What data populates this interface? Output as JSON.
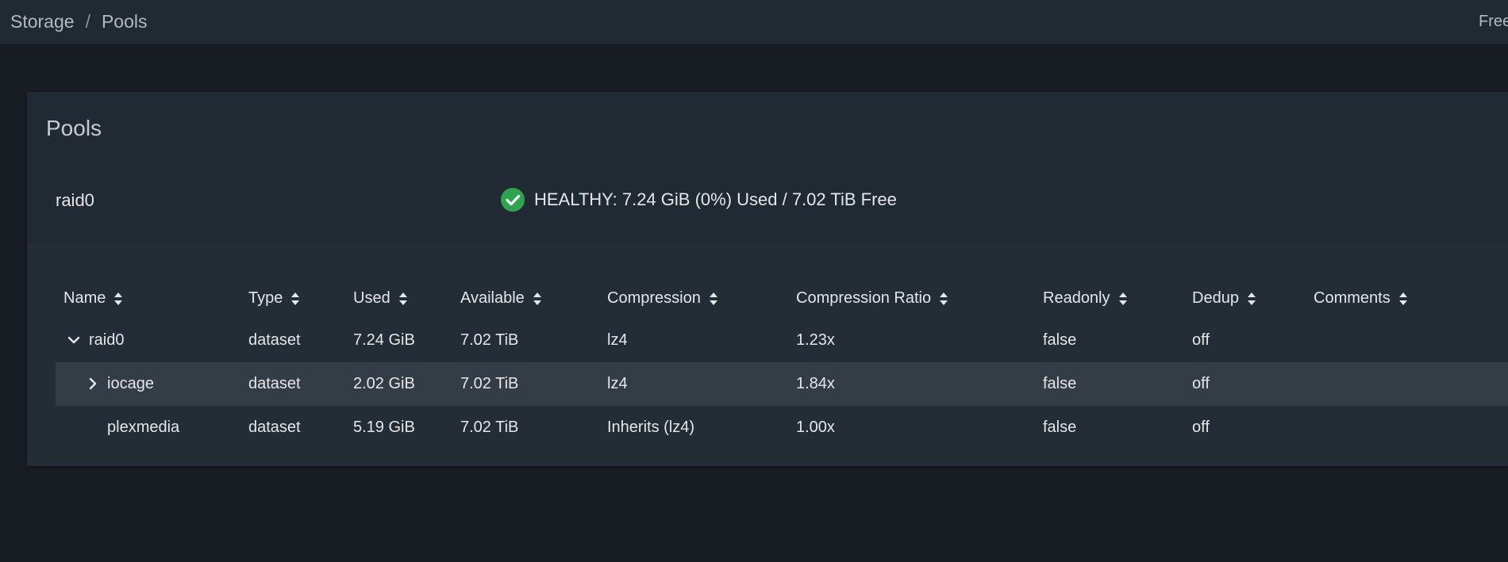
{
  "breadcrumb": {
    "items": [
      "Storage",
      "Pools"
    ],
    "separator": "/"
  },
  "top_right_text": "Free",
  "card": {
    "title": "Pools"
  },
  "pool": {
    "name": "raid0",
    "status_icon": "check-circle-icon",
    "status_color": "#2ea44f",
    "status_text": "HEALTHY: 7.24 GiB (0%) Used / 7.02 TiB Free"
  },
  "table": {
    "columns": [
      "Name",
      "Type",
      "Used",
      "Available",
      "Compression",
      "Compression Ratio",
      "Readonly",
      "Dedup",
      "Comments"
    ],
    "rows": [
      {
        "name": "raid0",
        "expander": "chevron-down-icon",
        "type": "dataset",
        "used": "7.24 GiB",
        "available": "7.02 TiB",
        "compression": "lz4",
        "ratio": "1.23x",
        "readonly": "false",
        "dedup": "off",
        "comments": ""
      },
      {
        "name": "iocage",
        "expander": "chevron-right-icon",
        "type": "dataset",
        "used": "2.02 GiB",
        "available": "7.02 TiB",
        "compression": "lz4",
        "ratio": "1.84x",
        "readonly": "false",
        "dedup": "off",
        "comments": ""
      },
      {
        "name": "plexmedia",
        "expander": "",
        "type": "dataset",
        "used": "5.19 GiB",
        "available": "7.02 TiB",
        "compression": "Inherits (lz4)",
        "ratio": "1.00x",
        "readonly": "false",
        "dedup": "off",
        "comments": ""
      }
    ]
  }
}
